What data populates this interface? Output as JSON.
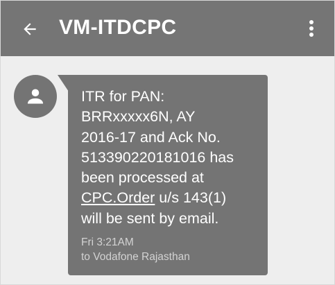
{
  "appbar": {
    "back_icon": "arrow-back-icon",
    "title": "VM-ITDCPC",
    "menu_icon": "more-vert-icon",
    "background": "#757575"
  },
  "conversation": {
    "avatar_icon": "person-icon",
    "message": {
      "line_1": "ITR for PAN:",
      "line_2": "BRRxxxxx6N, AY",
      "line_3": "2016-17 and Ack No.",
      "line_4": "513390220181016 has",
      "line_5": "been processed at",
      "link_text": "CPC.Order",
      "line_6_rest": " u/s 143(1)",
      "line_7": "will be sent by email.",
      "timestamp": "Fri 3:21AM",
      "carrier": "to Vodafone Rajasthan"
    },
    "bubble_color": "#747474"
  }
}
